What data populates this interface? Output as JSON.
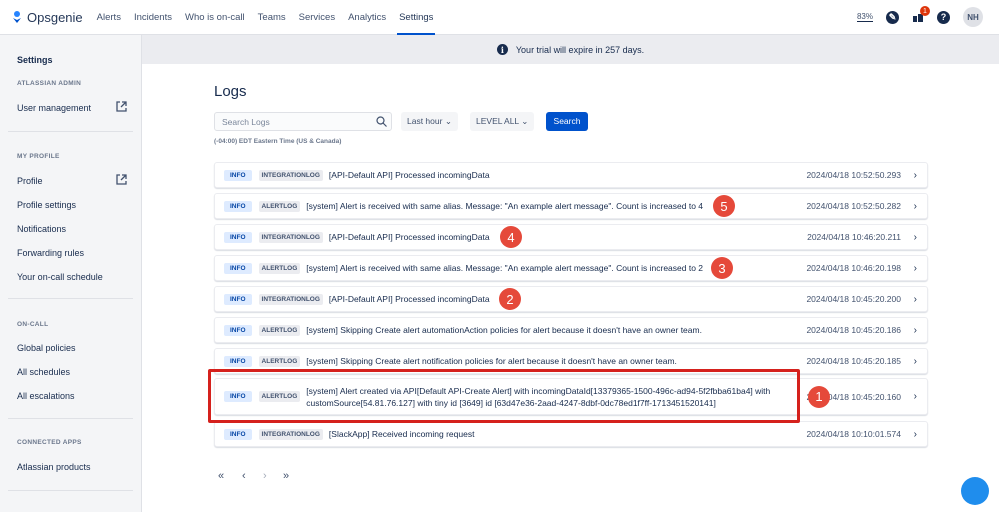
{
  "nav": {
    "brand": "Opsgenie",
    "items": [
      "Alerts",
      "Incidents",
      "Who is on-call",
      "Teams",
      "Services",
      "Analytics",
      "Settings"
    ],
    "active": "Settings",
    "zoom": "83%",
    "notification_count": "1",
    "avatar": "NH"
  },
  "sidebar": {
    "title": "Settings",
    "sections": [
      {
        "heading": "ATLASSIAN ADMIN",
        "items": [
          "User management"
        ]
      },
      {
        "heading": "MY PROFILE",
        "items": [
          "Profile",
          "Profile settings",
          "Notifications",
          "Forwarding rules",
          "Your on-call schedule"
        ]
      },
      {
        "heading": "ON-CALL",
        "items": [
          "Global policies",
          "All schedules",
          "All escalations"
        ]
      },
      {
        "heading": "CONNECTED APPS",
        "items": [
          "Atlassian products"
        ]
      }
    ]
  },
  "banner": "Your trial will expire in 257 days.",
  "page": {
    "title": "Logs",
    "search_placeholder": "Search Logs",
    "time_filter": "Last hour",
    "level_filter": "LEVEL ALL",
    "search_button": "Search",
    "timezone": "(-04:00) EDT Eastern Time (US & Canada)"
  },
  "logs": [
    {
      "level": "INFO",
      "type": "INTEGRATIONLOG",
      "message": "[API-Default API] Processed incomingData",
      "timestamp": "2024/04/18 10:52:50.293"
    },
    {
      "level": "INFO",
      "type": "ALERTLOG",
      "message": "[system] Alert is received with same alias. Message: \"An example alert message\". Count is increased to 4",
      "timestamp": "2024/04/18 10:52:50.282",
      "marker": "5"
    },
    {
      "level": "INFO",
      "type": "INTEGRATIONLOG",
      "message": "[API-Default API] Processed incomingData",
      "timestamp": "2024/04/18 10:46:20.211",
      "marker": "4"
    },
    {
      "level": "INFO",
      "type": "ALERTLOG",
      "message": "[system] Alert is received with same alias. Message: \"An example alert message\". Count is increased to 2",
      "timestamp": "2024/04/18 10:46:20.198",
      "marker": "3"
    },
    {
      "level": "INFO",
      "type": "INTEGRATIONLOG",
      "message": "[API-Default API] Processed incomingData",
      "timestamp": "2024/04/18 10:45:20.200",
      "marker": "2"
    },
    {
      "level": "INFO",
      "type": "ALERTLOG",
      "message": "[system] Skipping Create alert automationAction policies for alert because it doesn't have an owner team.",
      "timestamp": "2024/04/18 10:45:20.186"
    },
    {
      "level": "INFO",
      "type": "ALERTLOG",
      "message": "[system] Skipping Create alert notification policies for alert because it doesn't have an owner team.",
      "timestamp": "2024/04/18 10:45:20.185"
    },
    {
      "level": "INFO",
      "type": "ALERTLOG",
      "message": "[system] Alert created via API[Default API-Create Alert] with incomingDataId[13379365-1500-496c-ad94-5f2fbba61ba4] with customSource[54.81.76.127] with tiny id [3649] id [63d47e36-2aad-4247-8dbf-0dc78ed1f7ff-1713451520141]",
      "timestamp": "2024/04/18 10:45:20.160",
      "marker": "1"
    },
    {
      "level": "INFO",
      "type": "INTEGRATIONLOG",
      "message": "[SlackApp] Received incoming request",
      "timestamp": "2024/04/18 10:10:01.574"
    }
  ],
  "pager": {
    "first": "«",
    "prev": "‹",
    "next": "›",
    "last": "»"
  }
}
